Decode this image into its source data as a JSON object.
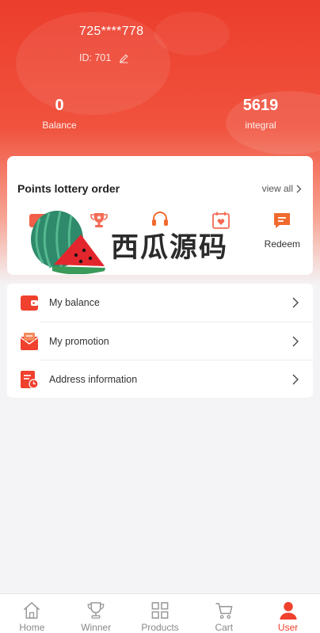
{
  "profile": {
    "phone": "725****778",
    "id_text": "ID: 701"
  },
  "stats": {
    "balance": {
      "value": "0",
      "label": "Balance"
    },
    "integral": {
      "value": "5619",
      "label": "integral"
    }
  },
  "order": {
    "title": "Points lottery order",
    "view_all": "view all",
    "items": [
      {
        "label": "To",
        "icon": "wallet-icon"
      },
      {
        "label": "",
        "icon": "trophy-icon"
      },
      {
        "label": "",
        "icon": "headset-icon"
      },
      {
        "label": "",
        "icon": "calendar-heart-icon"
      },
      {
        "label": "Redeem",
        "icon": "chat-icon"
      }
    ]
  },
  "watermark": {
    "text": "西瓜源码"
  },
  "menu": {
    "items": [
      {
        "label": "My balance",
        "icon": "wallet-icon"
      },
      {
        "label": "My promotion",
        "icon": "envelope-icon"
      },
      {
        "label": "Address information",
        "icon": "document-clock-icon"
      }
    ]
  },
  "tabbar": {
    "tabs": [
      {
        "label": "Home",
        "icon": "home-icon"
      },
      {
        "label": "Winner",
        "icon": "trophy-icon"
      },
      {
        "label": "Products",
        "icon": "grid-icon"
      },
      {
        "label": "Cart",
        "icon": "cart-icon"
      },
      {
        "label": "User",
        "icon": "user-icon",
        "active": true
      }
    ]
  },
  "colors": {
    "accent": "#f0402e",
    "header_top": "#ec3d2c"
  }
}
